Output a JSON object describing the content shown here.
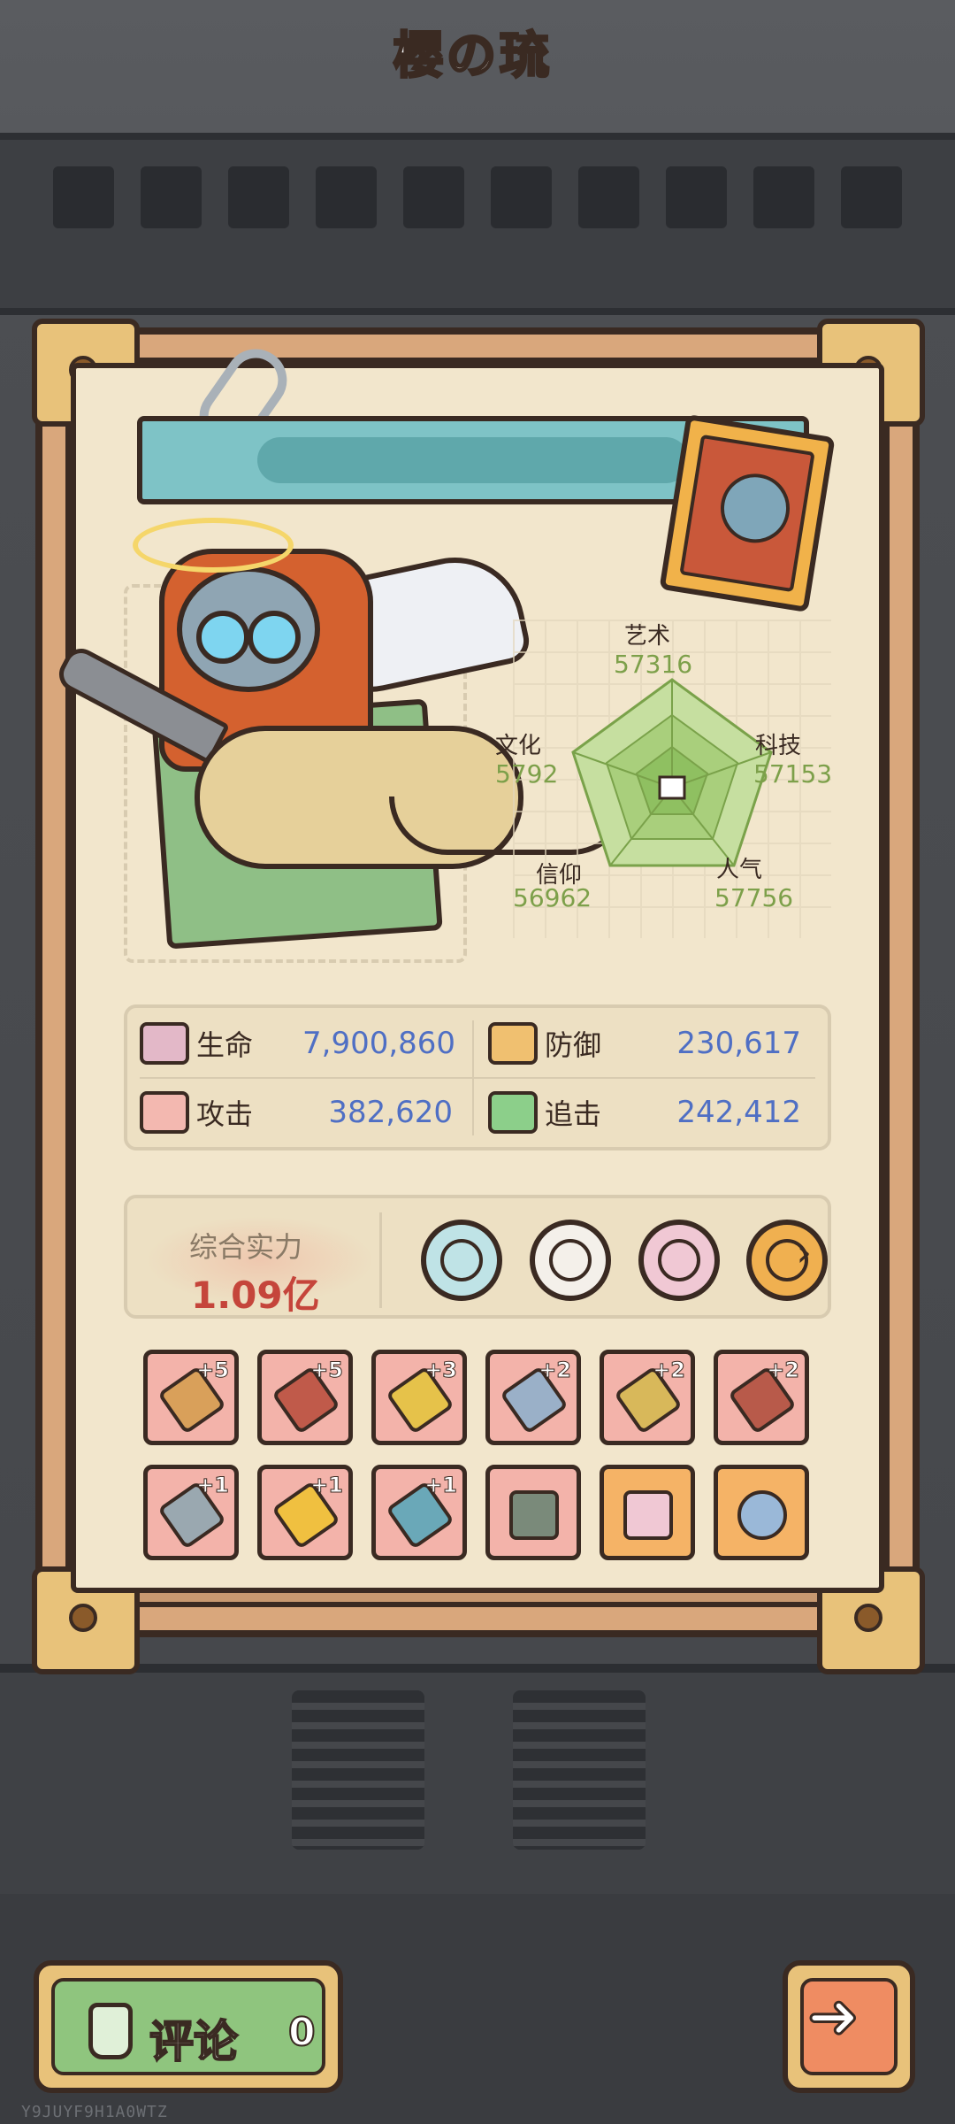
{
  "character": {
    "name": "樱の琉"
  },
  "attributes": [
    {
      "label": "艺术",
      "value": "57316"
    },
    {
      "label": "科技",
      "value": "57153"
    },
    {
      "label": "人气",
      "value": "57756"
    },
    {
      "label": "信仰",
      "value": "56962"
    },
    {
      "label": "文化",
      "value": "5792"
    }
  ],
  "stats": [
    {
      "label": "生命",
      "value": "7,900,860",
      "color": "#e3b8c8"
    },
    {
      "label": "防御",
      "value": "230,617",
      "color": "#f0c070"
    },
    {
      "label": "攻击",
      "value": "382,620",
      "color": "#f3b8b0"
    },
    {
      "label": "追击",
      "value": "242,412",
      "color": "#8ccf8a"
    }
  ],
  "power": {
    "label": "综合实力",
    "value": "1.09亿"
  },
  "skills": [
    {
      "icon": "dragon-skill-icon",
      "color": "#bfe3e6"
    },
    {
      "icon": "screaming-mask-skill-icon",
      "color": "#f4f0ea"
    },
    {
      "icon": "rune-scroll-skill-icon",
      "color": "#f0c8d4"
    },
    {
      "icon": "gear-skill-icon",
      "color": "#f0b050"
    }
  ],
  "equipment": [
    {
      "level": "+5",
      "icon": "crossbow-icon",
      "color": "#f3b3aa"
    },
    {
      "level": "+5",
      "icon": "rocket-sword-icon",
      "color": "#f3b3aa"
    },
    {
      "level": "+3",
      "icon": "star-spear-icon",
      "color": "#f3b3aa"
    },
    {
      "level": "+2",
      "icon": "dagger-icon",
      "color": "#f3b3aa"
    },
    {
      "level": "+2",
      "icon": "serpent-staff-icon",
      "color": "#f3b3aa"
    },
    {
      "level": "+2",
      "icon": "blade-icon",
      "color": "#f3b3aa"
    },
    {
      "level": "+1",
      "icon": "hammer-icon",
      "color": "#f3b3aa"
    },
    {
      "level": "+1",
      "icon": "golden-trophy-icon",
      "color": "#f3b3aa"
    },
    {
      "level": "+1",
      "icon": "trident-icon",
      "color": "#f3b3aa"
    },
    {
      "level": "",
      "icon": "backpack-icon",
      "color": "#f3b3aa"
    },
    {
      "level": "",
      "icon": "vest-icon",
      "color": "#f5b366"
    },
    {
      "level": "",
      "icon": "ring-icon",
      "color": "#f5b366"
    }
  ],
  "footer": {
    "comment_label": "评论",
    "comment_count": "0",
    "next_icon": "right-arrow-icon"
  },
  "watermark": "Y9JUYF9H1A0WTZ"
}
